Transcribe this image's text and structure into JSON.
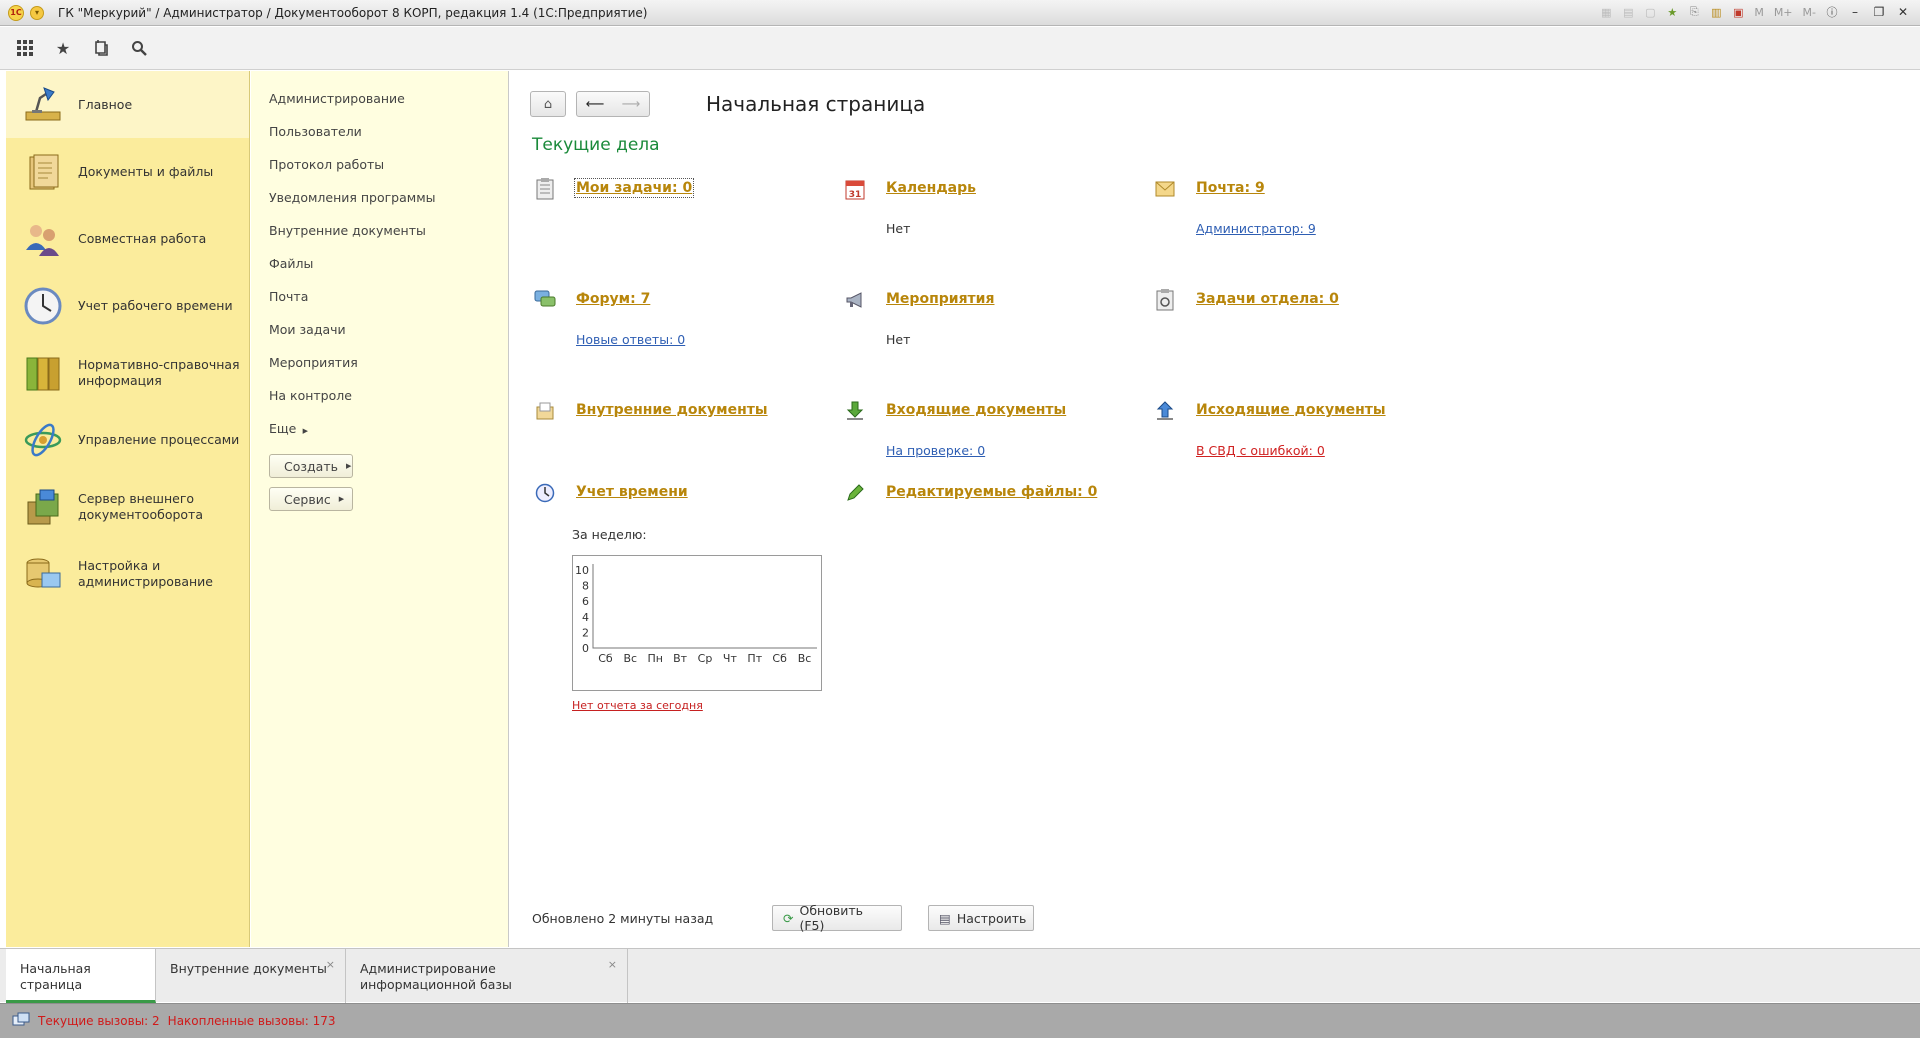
{
  "window": {
    "title": "ГК \"Меркурий\" / Администратор / Документооборот 8 КОРП, редакция 1.4  (1С:Предприятие)",
    "logo_text": "1С",
    "title_tool_m1": "M",
    "title_tool_m2": "M+",
    "title_tool_m3": "M-"
  },
  "toolbar": {
    "icons": [
      "apps-grid-icon",
      "favorites-star-icon",
      "history-icon",
      "search-icon"
    ]
  },
  "sections": [
    {
      "label": "Главное",
      "icon": "desk-lamp-icon",
      "active": true
    },
    {
      "label": "Документы и файлы",
      "icon": "documents-icon"
    },
    {
      "label": "Совместная работа",
      "icon": "users-icon"
    },
    {
      "label": "Учет рабочего времени",
      "icon": "clock-icon"
    },
    {
      "label": "Нормативно-справочная информация",
      "icon": "binders-icon"
    },
    {
      "label": "Управление процессами",
      "icon": "process-icon"
    },
    {
      "label": "Сервер внешнего документооборота",
      "icon": "server-icon"
    },
    {
      "label": "Настройка и администрирование",
      "icon": "admin-icon"
    }
  ],
  "functions": {
    "items": [
      "Администрирование",
      "Пользователи",
      "Протокол работы",
      "Уведомления программы",
      "Внутренние документы",
      "Файлы",
      "Почта",
      "Мои задачи",
      "Мероприятия",
      "На контроле"
    ],
    "more": "Еще",
    "create_button": "Создать",
    "service_button": "Сервис"
  },
  "main": {
    "title": "Начальная страница",
    "section_title": "Текущие дела",
    "cards": {
      "my_tasks": {
        "head": "Мои задачи: 0",
        "icon": "tasks-list-icon"
      },
      "calendar": {
        "head": "Календарь",
        "sub": "Нет",
        "icon": "calendar-icon",
        "icon_text": "31"
      },
      "mail": {
        "head": "Почта: 9",
        "sub": "Администратор: 9",
        "icon": "envelope-icon"
      },
      "forum": {
        "head": "Форум: 7",
        "sub": "Новые ответы: 0",
        "icon": "forum-icon"
      },
      "events": {
        "head": "Мероприятия",
        "sub": "Нет",
        "icon": "megaphone-icon"
      },
      "dept_tasks": {
        "head": "Задачи отдела: 0",
        "icon": "dept-tasks-icon"
      },
      "internal_docs": {
        "head": "Внутренние документы",
        "icon": "internal-docs-icon"
      },
      "incoming_docs": {
        "head": "Входящие документы",
        "sub": "На проверке: 0",
        "icon": "incoming-arrow-icon"
      },
      "outgoing_docs": {
        "head": "Исходящие документы",
        "sub": "В СВД с ошибкой: 0",
        "icon": "outgoing-arrow-icon"
      },
      "time_tracking": {
        "head": "Учет времени",
        "icon": "time-clock-icon"
      },
      "edited_files": {
        "head": "Редактируемые файлы: 0",
        "icon": "pencil-icon"
      }
    },
    "week_label": "За неделю:",
    "no_report": "Нет отчета за сегодня",
    "updated_text": "Обновлено 2 минуты назад",
    "refresh_button": "Обновить (F5)",
    "configure_button": "Настроить"
  },
  "chart_data": {
    "type": "bar",
    "categories": [
      "Сб",
      "Вс",
      "Пн",
      "Вт",
      "Ср",
      "Чт",
      "Пт",
      "Сб",
      "Вс"
    ],
    "values": [
      0,
      0,
      0,
      0,
      0,
      0,
      0,
      0,
      0
    ],
    "y_ticks": [
      "10",
      "8",
      "6",
      "4",
      "2",
      "0"
    ],
    "ylim": [
      0,
      10
    ],
    "title": "",
    "xlabel": "",
    "ylabel": "",
    "grid": false
  },
  "tabs": [
    {
      "label": "Начальная страница",
      "active": true
    },
    {
      "label": "Внутренние документы",
      "close": "×"
    },
    {
      "label": "Администрирование информационной базы",
      "close": "×"
    }
  ],
  "status": {
    "current_calls": "Текущие вызовы: 2",
    "accumulated_calls": "Накопленные вызовы: 173"
  },
  "colors": {
    "sections_bg": "#fbec9c",
    "functions_bg": "#fffee0",
    "link_gold": "#b8860b",
    "link_blue": "#2e5eb3",
    "link_red": "#d02222",
    "title_green": "#1a8a3a",
    "status_red": "#d01a1a"
  }
}
